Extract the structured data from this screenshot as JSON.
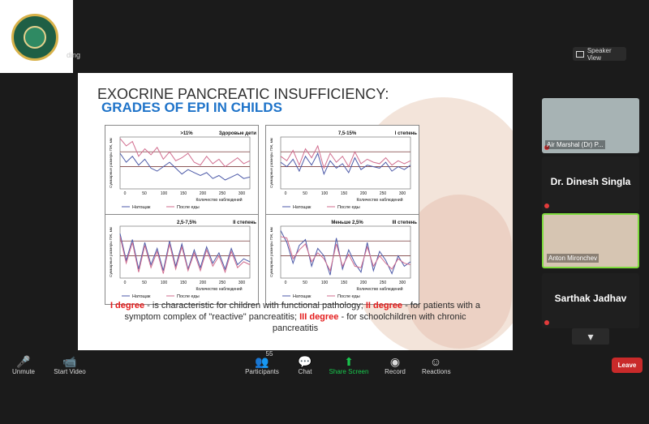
{
  "window": {
    "recording_label": "ding"
  },
  "speaker": {
    "label": "Speaker View",
    "icon": "grid-icon"
  },
  "slide": {
    "title": "EXOCRINE PANCREATIC INSUFFICIENCY:",
    "subtitle": "GRADES OF EPI IN CHILDS",
    "body": {
      "segments": [
        {
          "text": "I degree",
          "red": true
        },
        {
          "text": " -  is characteristic for children with functional pathology; ",
          "red": false
        },
        {
          "text": "II degree",
          "red": true
        },
        {
          "text": " - for patients with a symptom complex of \"reactive\" pancreatitis; ",
          "red": false
        },
        {
          "text": "III degree",
          "red": true
        },
        {
          "text": " - for schoolchildren with chronic pancreatitis",
          "red": false
        }
      ]
    },
    "charts": [
      {
        "title_left": ">11%",
        "title_right": "Здоровые дети",
        "legend": [
          "Натощак",
          "После еды"
        ],
        "xlabel": "Количество наблюдений",
        "ylabel": "Суммарные размеры ПЖ, мм",
        "ticks": [
          "0",
          "50",
          "100",
          "150",
          "200",
          "250",
          "300"
        ],
        "series1": [
          44,
          38,
          42,
          36,
          40,
          34,
          32,
          35,
          38,
          34,
          30,
          33,
          31,
          29,
          31,
          27,
          29,
          26,
          28,
          30,
          27,
          28
        ],
        "series2": [
          54,
          49,
          52,
          42,
          47,
          43,
          48,
          40,
          45,
          39,
          41,
          44,
          38,
          36,
          42,
          37,
          40,
          35,
          38,
          41,
          37,
          39
        ]
      },
      {
        "title_left": "7,5-15%",
        "title_right": "I степень",
        "legend": [
          "Натощак",
          "После еды"
        ],
        "xlabel": "Количество наблюдений",
        "ylabel": "Суммарные размеры ПЖ, мм",
        "ticks": [
          "0",
          "50",
          "100",
          "150",
          "200",
          "250",
          "300"
        ],
        "series1": [
          38,
          35,
          40,
          32,
          42,
          36,
          44,
          30,
          39,
          34,
          37,
          31,
          41,
          33,
          36,
          35,
          34,
          38,
          32,
          35,
          33,
          36
        ],
        "series2": [
          42,
          39,
          46,
          36,
          47,
          41,
          49,
          34,
          44,
          38,
          42,
          35,
          45,
          37,
          40,
          38,
          37,
          41,
          36,
          39,
          37,
          39
        ]
      },
      {
        "title_left": "2,5-7,5%",
        "title_right": "II степень",
        "legend": [
          "Натощак",
          "После еды"
        ],
        "xlabel": "Количество наблюдений",
        "ylabel": "Суммарные размеры ПЖ, мм",
        "ticks": [
          "0",
          "50",
          "100",
          "150",
          "200",
          "250",
          "300"
        ],
        "series1": [
          50,
          32,
          46,
          26,
          44,
          29,
          40,
          25,
          45,
          28,
          43,
          26,
          39,
          27,
          41,
          30,
          37,
          26,
          40,
          29,
          33,
          31
        ],
        "series2": [
          48,
          30,
          44,
          24,
          42,
          27,
          38,
          23,
          43,
          26,
          41,
          25,
          37,
          25,
          39,
          28,
          35,
          24,
          38,
          27,
          31,
          29
        ]
      },
      {
        "title_left": "Меньше 2,5%",
        "title_right": "III степень",
        "legend": [
          "Натощак",
          "После еды"
        ],
        "xlabel": "Количество наблюдений",
        "ylabel": "Суммарные размеры ПЖ, мм",
        "ticks": [
          "0",
          "50",
          "100",
          "150",
          "200",
          "250",
          "300"
        ],
        "series1": [
          52,
          44,
          30,
          42,
          46,
          28,
          40,
          35,
          22,
          47,
          26,
          39,
          30,
          24,
          44,
          25,
          38,
          32,
          23,
          35,
          28,
          31
        ],
        "series2": [
          48,
          47,
          33,
          39,
          43,
          31,
          37,
          33,
          25,
          43,
          28,
          36,
          28,
          27,
          41,
          28,
          35,
          30,
          26,
          33,
          30,
          29
        ]
      }
    ],
    "colors": {
      "series1": "#4d5aa8",
      "series2": "#d16d8e",
      "ref_line": "#7b3f3f"
    }
  },
  "participants": [
    {
      "name": "Air Marshal (Dr) P...",
      "muted": true,
      "mode": "video"
    },
    {
      "name": "Dr. Dinesh Singla",
      "muted": true,
      "mode": "name"
    },
    {
      "name": "Anton Mironchev",
      "muted": false,
      "mode": "video"
    },
    {
      "name": "Sarthak Jadhav",
      "muted": true,
      "mode": "name"
    }
  ],
  "toolbar": {
    "unmute": "Unmute",
    "video": "Start Video",
    "participants": "Participants",
    "participants_count": "55",
    "chat": "Chat",
    "share": "Share Screen",
    "record": "Record",
    "reactions": "Reactions",
    "leave": "Leave"
  }
}
